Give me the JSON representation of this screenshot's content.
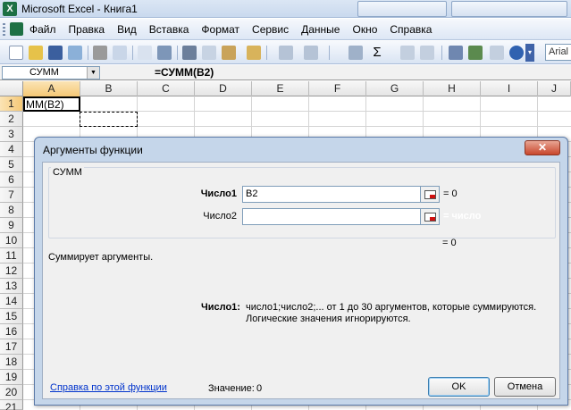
{
  "window": {
    "title": "Microsoft Excel - Книга1",
    "app_icon": "excel-icon"
  },
  "menu": {
    "items": [
      "Файл",
      "Правка",
      "Вид",
      "Вставка",
      "Формат",
      "Сервис",
      "Данные",
      "Окно",
      "Справка"
    ]
  },
  "toolbar": {
    "font_name": "Arial"
  },
  "formula_bar": {
    "name_box": "СУММ",
    "formula": "=СУММ(B2)"
  },
  "sheet": {
    "columns": [
      "A",
      "B",
      "C",
      "D",
      "E",
      "F",
      "G",
      "H",
      "I",
      "J"
    ],
    "rows": [
      "1",
      "2",
      "3",
      "4",
      "5",
      "6",
      "7",
      "8",
      "9",
      "10",
      "11",
      "12",
      "13",
      "14",
      "15",
      "16",
      "17",
      "18",
      "19",
      "20",
      "21"
    ],
    "active_cell_text": "ММ(B2)",
    "selected_column": "A",
    "selected_row": "1"
  },
  "dialog": {
    "title": "Аргументы функции",
    "close_icon": "close-icon",
    "function_name": "СУММ",
    "args": [
      {
        "label": "Число1",
        "value": "B2",
        "result": "= 0"
      },
      {
        "label": "Число2",
        "value": "",
        "result": "= число"
      }
    ],
    "total_result": "= 0",
    "description": "Суммирует аргументы.",
    "arg_desc_label": "Число1:",
    "arg_desc_text": "число1;число2;... от 1 до 30 аргументов, которые суммируются. Логические значения игнорируются.",
    "help_link": "Справка по этой функции",
    "value_label": "Значение:",
    "value": "0",
    "ok_label": "OK",
    "cancel_label": "Отмена"
  }
}
